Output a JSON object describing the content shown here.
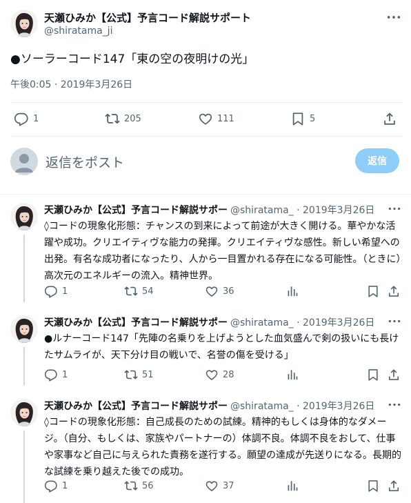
{
  "main_tweet": {
    "author_name": "天瀬ひみか【公式】予言コード解説サポート",
    "author_handle": "@shiratama_ji",
    "text": "●ソーラーコード147「東の空の夜明けの光」",
    "timestamp": "午後0:05 · 2019年3月26日",
    "stats": {
      "replies": "1",
      "retweets": "205",
      "likes": "111",
      "bookmarks": "5"
    }
  },
  "reply_box": {
    "placeholder": "返信をポスト",
    "button_label": "返信"
  },
  "replies": [
    {
      "author_name": "天瀬ひみか【公式】予言コード解説サポー",
      "meta": "@shiratama_ · 2019年3月26日",
      "text": "◊コードの現象化形態：チャンスの到来によって前途が大きく開ける。華やかな活躍や成功。クリエイティヴな能力の発揮。クリエイティヴな感性。新しい希望への出発。有名な成功者になったり、人から一目置かれる存在になる可能性。（ときに）高次元のエネルギーの流入。精神世界。",
      "replies": "1",
      "retweets": "54",
      "likes": "36"
    },
    {
      "author_name": "天瀬ひみか【公式】予言コード解説サポー",
      "meta": "@shiratama_ · 2019年3月26日",
      "text": "●ルナーコード147「先陣の名乗りを上げようとした血気盛んで剣の扱いにも長けたサムライが、天下分け目の戦いで、名誉の傷を受ける」",
      "replies": "1",
      "retweets": "51",
      "likes": "28"
    },
    {
      "author_name": "天瀬ひみか【公式】予言コード解説サポー",
      "meta": "@shiratama_ · 2019年3月26日",
      "text": "◊コードの現象化形態：自己成長のための試練。精神的もしくは身体的なダメージ。（自分、もしくは、家族やパートナーの）体調不良。体調不良をおして、仕事や家事など自己に与えられた責務を遂行する。願望の達成が先送りになる。長期的な試練を乗り越えた後での成功。",
      "replies": "1",
      "retweets": "56",
      "likes": "37"
    }
  ],
  "icons": {
    "avatar": "avatar-illustration",
    "reply": "speech-bubble-icon",
    "retweet": "retweet-arrows-icon",
    "like": "heart-icon",
    "bookmark": "bookmark-icon",
    "share": "share-upload-icon",
    "views": "bar-chart-icon",
    "more": "more-dots-icon"
  },
  "colors": {
    "text": "#0f1419",
    "secondary": "#536471",
    "divider": "#eff3f4",
    "reply_button": "#8ecdf8",
    "thread_line": "#cfd9de"
  }
}
